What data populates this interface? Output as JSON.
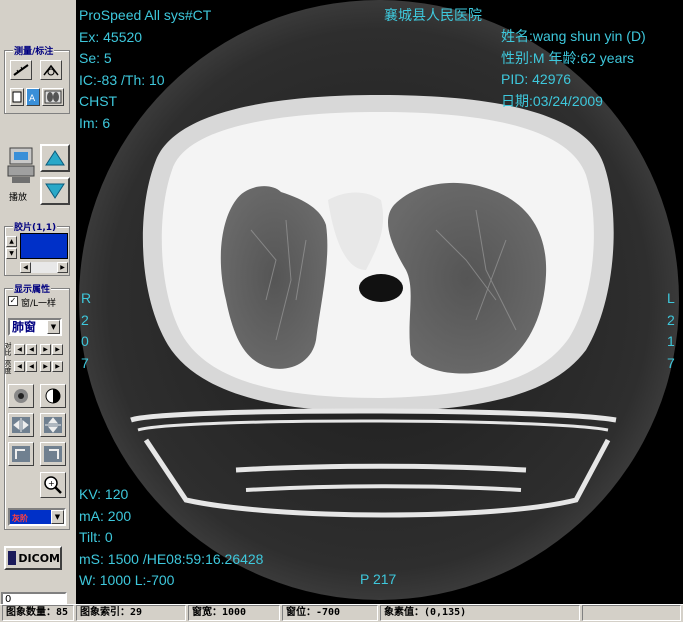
{
  "toolbar": {
    "measure_title": "测量/标注",
    "play_label": "播放",
    "film_title": "胶片(1,1)",
    "display_title": "显示属性",
    "same_checkbox_label": "窗/L一样",
    "window_preset": "肺窗",
    "contrast_label": "对比",
    "bright_label": "亮度",
    "color_combo_label": "灰阶",
    "dicom_label": "DICOM",
    "frame_input_value": "0"
  },
  "overlay": {
    "tl": [
      "ProSpeed All  sys#CT",
      "Ex: 45520",
      "Se: 5",
      "IC:-83 /Th: 10",
      "CHST",
      "Im: 6"
    ],
    "hospital": "襄城县人民医院",
    "tr": [
      "姓名:wang shun yin (D)",
      "性别:M  年龄:62 years",
      "PID: 42976",
      "日期:03/24/2009"
    ],
    "left_orient": [
      "R",
      "2",
      "0",
      "7"
    ],
    "right_orient": [
      "L",
      "2",
      "1",
      "7"
    ],
    "bl": [
      "KV: 120",
      "mA: 200",
      "Tilt: 0",
      "mS: 1500  /HE08:59:16.26428",
      "W: 1000 L:-700"
    ],
    "position": "P 217"
  },
  "status": {
    "image_count": "图象数量：85",
    "image_index": "图象索引：29",
    "window_width": "窗宽：1000",
    "window_level": "窗位：-700",
    "pixel_value": "象素值：(0,135)"
  },
  "colors": {
    "overlay_text": "#3ec8dc",
    "film_blue": "#0030c8",
    "arrow_cyan": "#29a8c8"
  }
}
